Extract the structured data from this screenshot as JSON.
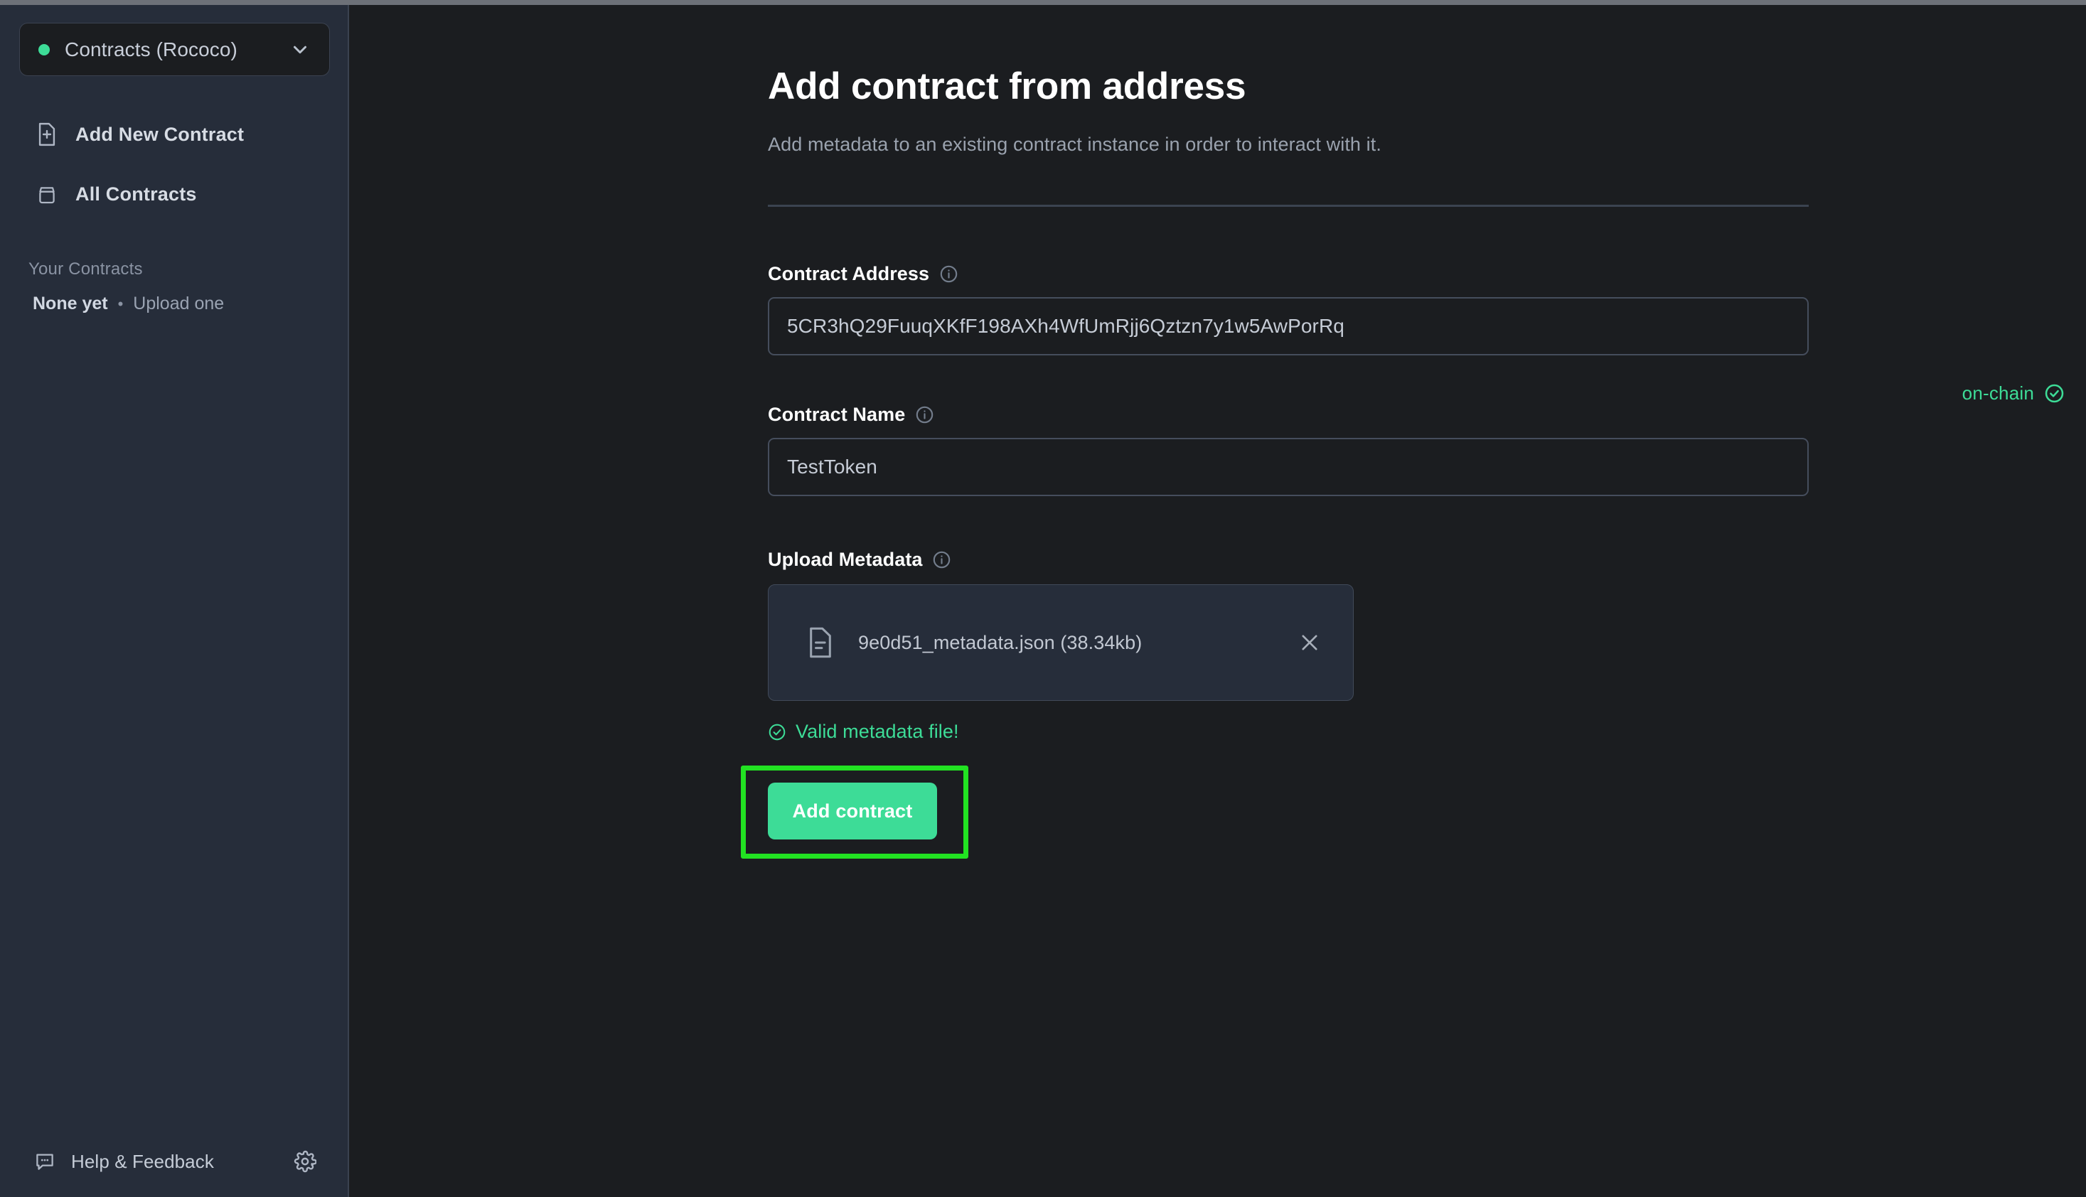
{
  "theme": {
    "accent": "#3ddc97",
    "sidebar_bg": "#262d3a",
    "main_bg": "#1b1d20",
    "highlight": "#22e222",
    "border": "#454d5c",
    "text_primary": "#ffffff",
    "text_muted": "#9aa2ae"
  },
  "sidebar": {
    "network_selector": {
      "label": "Contracts (Rococo)",
      "status_dot_color": "#3ddc97",
      "chevron_icon": "chevron-down-icon"
    },
    "nav_items": [
      {
        "label": "Add New Contract",
        "icon": "file-plus-icon"
      },
      {
        "label": "All Contracts",
        "icon": "archive-icon"
      }
    ],
    "your_contracts": {
      "title": "Your Contracts",
      "empty_label": "None yet",
      "separator": "•",
      "upload_link": "Upload one"
    },
    "footer": {
      "help_label": "Help & Feedback",
      "help_icon": "chat-bubble-icon",
      "settings_icon": "gear-icon"
    }
  },
  "main": {
    "title": "Add contract from address",
    "subtitle": "Add metadata to an existing contract instance in order to interact with it.",
    "status_badge": {
      "label": "on-chain",
      "icon": "check-circle-icon",
      "color": "#3ddc97"
    },
    "fields": {
      "address": {
        "label": "Contract Address",
        "info_icon": "info-icon",
        "value": "5CR3hQ29FuuqXKfF198AXh4WfUmRjj6Qztzn7y1w5AwPorRq",
        "placeholder": "Contract address"
      },
      "name": {
        "label": "Contract Name",
        "info_icon": "info-icon",
        "value": "TestToken",
        "placeholder": "Contract name"
      },
      "metadata": {
        "label": "Upload Metadata",
        "info_icon": "info-icon",
        "file_icon": "file-text-icon",
        "file_name": "9e0d51_metadata.json (38.34kb)",
        "remove_icon": "close-icon",
        "validation_message": "Valid metadata file!",
        "validation_icon": "check-circle-icon"
      }
    },
    "submit_button": {
      "label": "Add contract"
    }
  }
}
